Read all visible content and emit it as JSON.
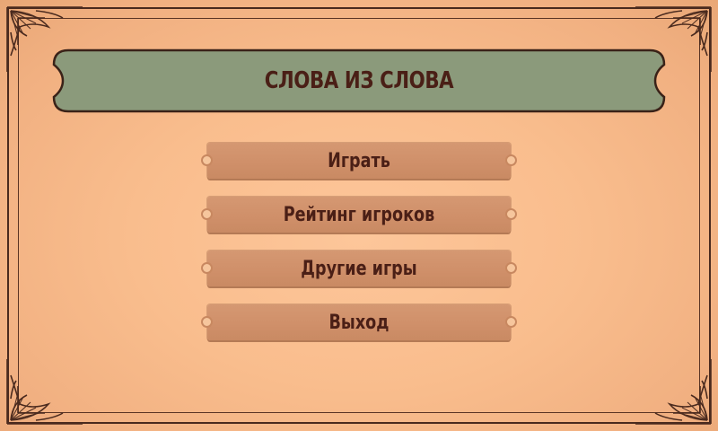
{
  "title": "СЛОВА ИЗ СЛОВА",
  "menu": {
    "items": [
      {
        "label": "Играть"
      },
      {
        "label": "Рейтинг игроков"
      },
      {
        "label": "Другие игры"
      },
      {
        "label": "Выход"
      }
    ]
  },
  "colors": {
    "background": "#f9bd8d",
    "banner": "#8b9a7b",
    "button": "#d09069",
    "text": "#4a1f16",
    "frame": "#4a2a1e"
  }
}
